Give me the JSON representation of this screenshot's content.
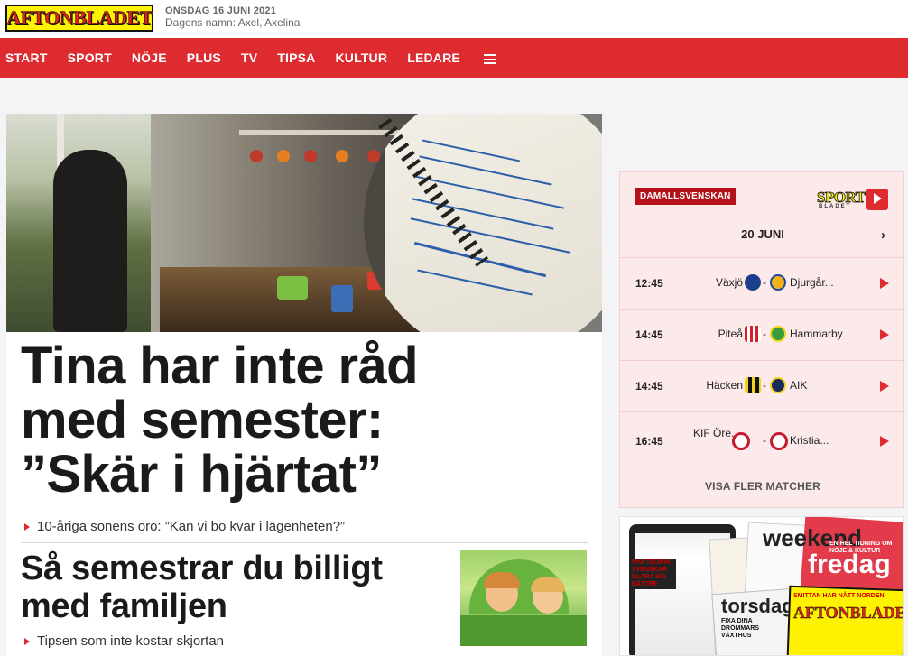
{
  "header": {
    "logo_text": "AFTONBLADET",
    "date": "ONSDAG 16 JUNI 2021",
    "name_day": "Dagens namn: Axel, Axelina"
  },
  "nav": {
    "items": [
      "START",
      "SPORT",
      "NÖJE",
      "PLUS",
      "TV",
      "TIPSA",
      "KULTUR",
      "LEDARE"
    ],
    "menu_icon": "hamburger-menu-icon"
  },
  "main": {
    "headline_lines": [
      "Tina har inte råd",
      "med semester:",
      "”Skär i hjärtat”"
    ],
    "subheadline": "10-åriga sonens oro: ”Kan vi bo kvar i lägenheten?”",
    "second_headline_lines": [
      "Så semestrar du billigt",
      "med familjen"
    ],
    "second_subheadline": "Tipsen som inte kostar skjortan"
  },
  "sport_widget": {
    "tag": "DAMALLSVENSKAN",
    "logo_text": "SPORT",
    "logo_sub": "BLADET",
    "logo_play": "Play",
    "date": "20 JUNI",
    "matches": [
      {
        "time": "12:45",
        "home": "Växjö",
        "away": "Djurgår...",
        "home_color": "#1b3f8b",
        "away_color": "#f2b21b"
      },
      {
        "time": "14:45",
        "home": "Piteå",
        "away": "Hammarby",
        "home_color": "#d8202d",
        "away_color": "#3a9c3c"
      },
      {
        "time": "14:45",
        "home": "Häcken",
        "away": "AIK",
        "home_color": "#f4d020",
        "away_color": "#1a2a5a"
      },
      {
        "time": "16:45",
        "home": "KIF Öre...",
        "away": "Kristia...",
        "home_color": "#c8182b",
        "away_color": "#c8182b"
      }
    ],
    "more_label": "VISA FLER MATCHER"
  },
  "magazines": {
    "weekend": "weekend",
    "fredag": "fredag",
    "torsdag": "torsdag",
    "aftonbladet": "AFTONBLADET",
    "text1": "EN HEL TIDNING OM NÖJE & KULTUR",
    "text2": "SMITTAN HAR NÅTT NORDEN",
    "text3": "NYA TEORIN SVENSKAR KLARA SIG BÄTTRE",
    "text4": "FIXA DINA DRÖMMARS VÄXTHUS"
  }
}
